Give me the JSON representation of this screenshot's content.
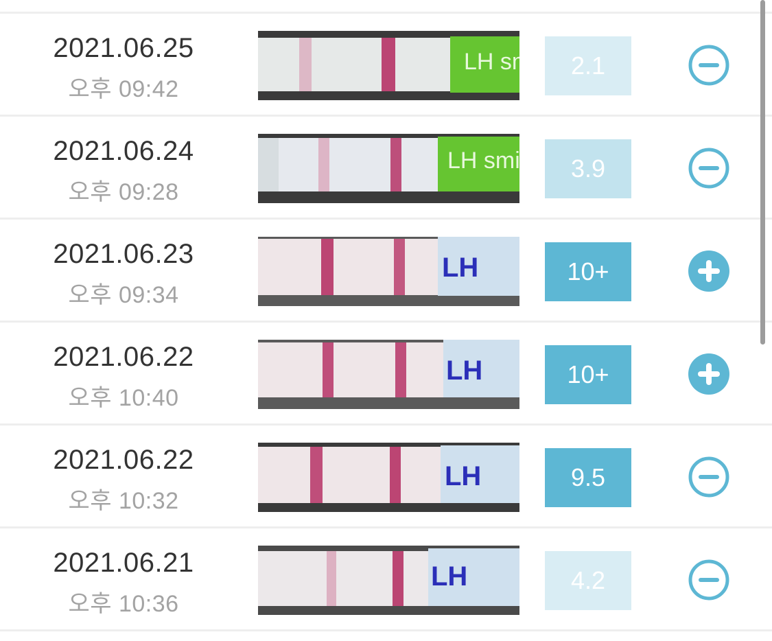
{
  "entries": [
    {
      "date": "2021.06.25",
      "time": "오후 09:42",
      "value": "2.1",
      "level": "light",
      "sign": "minus",
      "strip_label": "LH smi",
      "strip_color": "#66c531"
    },
    {
      "date": "2021.06.24",
      "time": "오후 09:28",
      "value": "3.9",
      "level": "mid",
      "sign": "minus",
      "strip_label": "LH smi",
      "strip_color": "#66c531"
    },
    {
      "date": "2021.06.23",
      "time": "오후 09:34",
      "value": "10+",
      "level": "strong",
      "sign": "plus",
      "strip_label": "LH",
      "strip_color": "#2b2fb8"
    },
    {
      "date": "2021.06.22",
      "time": "오후 10:40",
      "value": "10+",
      "level": "strong",
      "sign": "plus",
      "strip_label": "LH",
      "strip_color": "#2b2fb8"
    },
    {
      "date": "2021.06.22",
      "time": "오후 10:32",
      "value": "9.5",
      "level": "strong",
      "sign": "minus",
      "strip_label": "LH",
      "strip_color": "#2b2fb8"
    },
    {
      "date": "2021.06.21",
      "time": "오후 10:36",
      "value": "4.2",
      "level": "light",
      "sign": "minus",
      "strip_label": "LH",
      "strip_color": "#2b2fb8"
    }
  ],
  "colors": {
    "accent": "#5db7d4",
    "value_light": "#d9edf4",
    "value_mid": "#c2e3ee",
    "line_faint": "#d9a3b8",
    "line_strong": "#b3285e"
  },
  "icons": {
    "minus": "minus-circle-icon",
    "plus": "plus-circle-icon"
  }
}
